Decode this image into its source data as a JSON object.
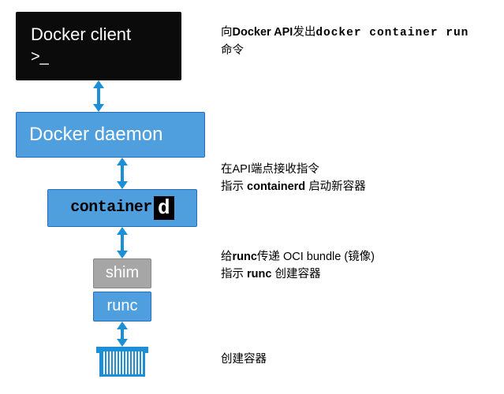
{
  "nodes": {
    "client": {
      "title": "Docker client",
      "prompt": ">_"
    },
    "daemon": {
      "title": "Docker daemon"
    },
    "containerd": {
      "text": "container",
      "badge": "d"
    },
    "shim": {
      "label": "shim"
    },
    "runc": {
      "label": "runc"
    }
  },
  "descriptions": {
    "client": {
      "pre": "向",
      "bold1": "Docker API",
      "mid": "发出",
      "mono": "docker container run",
      "post": "命令"
    },
    "daemon": {
      "line1_pre": "在API端点接收指令",
      "line2_pre": "指示",
      "line2_bold": "containerd",
      "line2_post": "启动新容器"
    },
    "containerd": {
      "line1_pre": "给",
      "line1_bold": "runc",
      "line1_mid": "传递 OCI bundle (镜像)",
      "line2_pre": "指示",
      "line2_bold": "runc",
      "line2_post": "创建容器"
    },
    "runc": {
      "line": "创建容器"
    }
  }
}
